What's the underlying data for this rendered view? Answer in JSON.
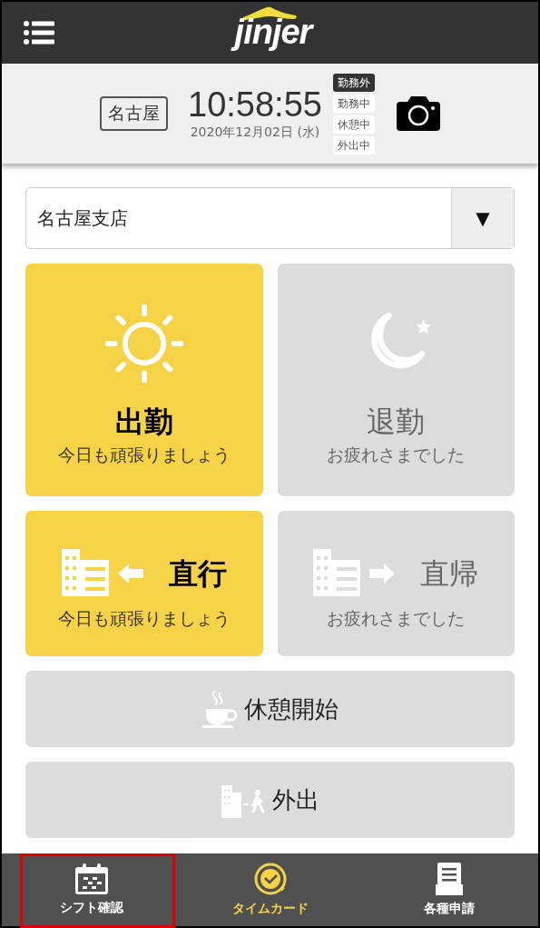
{
  "header": {
    "logo": "jinjer"
  },
  "status_panel": {
    "location": "名古屋",
    "time": "10:58:55",
    "date": "2020年12月02日 (水)",
    "statuses": [
      {
        "label": "勤務外",
        "selected": true
      },
      {
        "label": "勤務中",
        "selected": false
      },
      {
        "label": "休憩中",
        "selected": false
      },
      {
        "label": "外出中",
        "selected": false
      }
    ]
  },
  "branch_select": {
    "value": "名古屋支店",
    "arrow": "▼"
  },
  "punch_tiles": [
    {
      "kind": "clock_in",
      "title": "出勤",
      "subtitle": "今日も頑張りましょう",
      "enabled": true
    },
    {
      "kind": "clock_out",
      "title": "退勤",
      "subtitle": "お疲れさまでした",
      "enabled": false
    },
    {
      "kind": "direct_go",
      "title": "直行",
      "subtitle": "今日も頑張りましょう",
      "enabled": true
    },
    {
      "kind": "direct_return",
      "title": "直帰",
      "subtitle": "お疲れさまでした",
      "enabled": false
    }
  ],
  "wide_buttons": [
    {
      "kind": "break",
      "label": "休憩開始"
    },
    {
      "kind": "outing",
      "label": "外出"
    }
  ],
  "bottom_nav": [
    {
      "kind": "shift",
      "label": "シフト確認",
      "selected": false,
      "highlighted": true
    },
    {
      "kind": "timecard",
      "label": "タイムカード",
      "selected": true,
      "highlighted": false
    },
    {
      "kind": "requests",
      "label": "各種申請",
      "selected": false,
      "highlighted": false
    }
  ]
}
